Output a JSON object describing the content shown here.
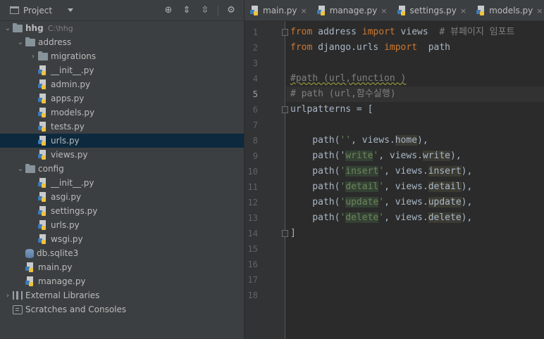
{
  "project_panel": {
    "title": "Project",
    "tools": [
      "locate-icon",
      "expand-all-icon",
      "collapse-all-icon",
      "gear-icon"
    ],
    "tree": [
      {
        "label": "hhg",
        "hint": "C:\\hhg",
        "kind": "folder",
        "expanded": true,
        "depth": 0,
        "bold": true
      },
      {
        "label": "address",
        "kind": "folder",
        "expanded": true,
        "depth": 1
      },
      {
        "label": "migrations",
        "kind": "folder",
        "expanded": false,
        "depth": 2
      },
      {
        "label": "__init__.py",
        "kind": "py",
        "depth": 2
      },
      {
        "label": "admin.py",
        "kind": "py",
        "depth": 2
      },
      {
        "label": "apps.py",
        "kind": "py",
        "depth": 2
      },
      {
        "label": "models.py",
        "kind": "py",
        "depth": 2
      },
      {
        "label": "tests.py",
        "kind": "py",
        "depth": 2
      },
      {
        "label": "urls.py",
        "kind": "py",
        "depth": 2,
        "selected": true
      },
      {
        "label": "views.py",
        "kind": "py",
        "depth": 2
      },
      {
        "label": "config",
        "kind": "folder",
        "expanded": true,
        "depth": 1
      },
      {
        "label": "__init__.py",
        "kind": "py",
        "depth": 2
      },
      {
        "label": "asgi.py",
        "kind": "py",
        "depth": 2
      },
      {
        "label": "settings.py",
        "kind": "py",
        "depth": 2
      },
      {
        "label": "urls.py",
        "kind": "py",
        "depth": 2
      },
      {
        "label": "wsgi.py",
        "kind": "py",
        "depth": 2
      },
      {
        "label": "db.sqlite3",
        "kind": "db",
        "depth": 1
      },
      {
        "label": "main.py",
        "kind": "py",
        "depth": 1
      },
      {
        "label": "manage.py",
        "kind": "py",
        "depth": 1
      },
      {
        "label": "External Libraries",
        "kind": "lib",
        "expanded": false,
        "depth": 0
      },
      {
        "label": "Scratches and Consoles",
        "kind": "scratch",
        "depth": 0
      }
    ]
  },
  "tabs": [
    {
      "label": "main.py",
      "active": false
    },
    {
      "label": "manage.py",
      "active": false
    },
    {
      "label": "settings.py",
      "active": false
    },
    {
      "label": "models.py",
      "active": false
    }
  ],
  "editor": {
    "line_numbers": [
      "1",
      "2",
      "3",
      "4",
      "5",
      "6",
      "7",
      "8",
      "9",
      "10",
      "11",
      "12",
      "13",
      "14",
      "15",
      "16",
      "17",
      "18"
    ],
    "current_line": 5,
    "lines": [
      [
        {
          "t": "from",
          "c": "kw"
        },
        {
          "t": " address "
        },
        {
          "t": "import",
          "c": "kw"
        },
        {
          "t": " views  "
        },
        {
          "t": "# 뷰페이지 임포트",
          "c": "cm"
        }
      ],
      [
        {
          "t": "from",
          "c": "kw"
        },
        {
          "t": " django.urls "
        },
        {
          "t": "import",
          "c": "kw"
        },
        {
          "t": "  "
        },
        {
          "t": "path"
        }
      ],
      [],
      [
        {
          "t": "#path (url,function )",
          "c": "cm wavy"
        }
      ],
      [
        {
          "t": "# path (url,함수실행)",
          "c": "cm"
        }
      ],
      [
        {
          "t": "urlpatterns = ["
        }
      ],
      [],
      [
        {
          "t": "    path("
        },
        {
          "t": "''",
          "c": "str"
        },
        {
          "t": ", views."
        },
        {
          "t": "home",
          "c": "hl"
        },
        {
          "t": "),"
        }
      ],
      [
        {
          "t": "    path("
        },
        {
          "t": "'"
        },
        {
          "t": "write",
          "c": "str hl2"
        },
        {
          "t": "'",
          "c": "str"
        },
        {
          "t": ", views."
        },
        {
          "t": "write",
          "c": "hl"
        },
        {
          "t": "),"
        }
      ],
      [
        {
          "t": "    path("
        },
        {
          "t": "'",
          "c": "str"
        },
        {
          "t": "insert",
          "c": "str hl2"
        },
        {
          "t": "'",
          "c": "str"
        },
        {
          "t": ", views."
        },
        {
          "t": "insert",
          "c": "hl"
        },
        {
          "t": "),"
        }
      ],
      [
        {
          "t": "    path("
        },
        {
          "t": "'",
          "c": "str"
        },
        {
          "t": "detail",
          "c": "str hl2"
        },
        {
          "t": "'",
          "c": "str"
        },
        {
          "t": ", views."
        },
        {
          "t": "detail",
          "c": "hl"
        },
        {
          "t": "),"
        }
      ],
      [
        {
          "t": "    path("
        },
        {
          "t": "'",
          "c": "str"
        },
        {
          "t": "update",
          "c": "str hl2"
        },
        {
          "t": "'",
          "c": "str"
        },
        {
          "t": ", views."
        },
        {
          "t": "update",
          "c": "hl"
        },
        {
          "t": "),"
        }
      ],
      [
        {
          "t": "    path("
        },
        {
          "t": "'",
          "c": "str"
        },
        {
          "t": "delete",
          "c": "str hl2"
        },
        {
          "t": "'",
          "c": "str"
        },
        {
          "t": ", views."
        },
        {
          "t": "delete",
          "c": "hl"
        },
        {
          "t": "),"
        }
      ],
      [
        {
          "t": "]"
        }
      ],
      [],
      [],
      [],
      []
    ]
  }
}
